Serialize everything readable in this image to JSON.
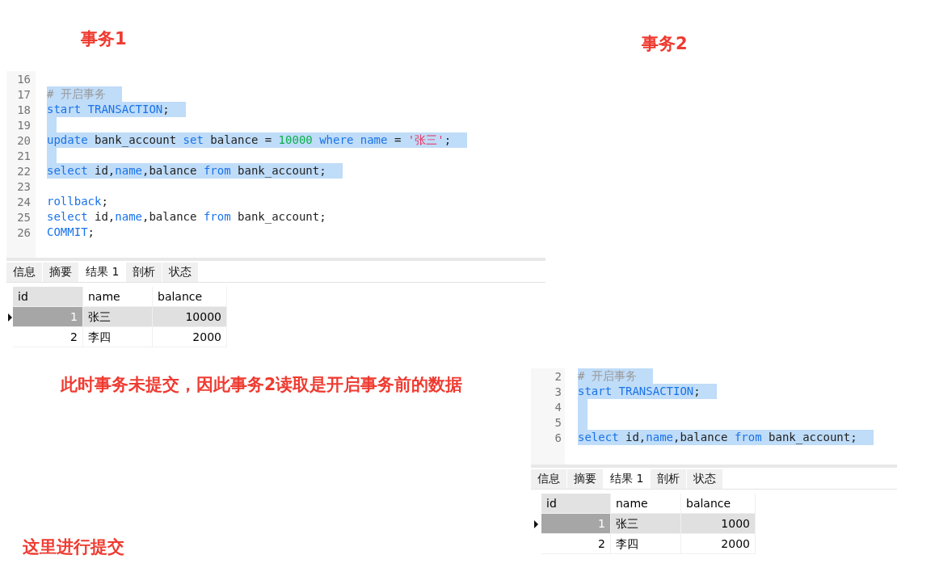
{
  "labels": {
    "transaction_1": "事务1",
    "transaction_2": "事务2",
    "note": "此时事务未提交，因此事务2读取是开启事务前的数据",
    "commit_note": "这里进行提交"
  },
  "editors": [
    {
      "lines": [
        {
          "number": "16",
          "selected": false
        },
        {
          "number": "17",
          "selected": true,
          "tokens": [
            {
              "kind": "comment",
              "text": "# 开启事务"
            }
          ]
        },
        {
          "number": "18",
          "selected": true,
          "tokens": [
            {
              "kind": "kw",
              "text": "start TRANSACTION"
            },
            {
              "kind": "plain",
              "text": ";"
            }
          ]
        },
        {
          "number": "19",
          "selected": true
        },
        {
          "number": "20",
          "selected": true,
          "tokens": [
            {
              "kind": "kw",
              "text": "update"
            },
            {
              "kind": "plain",
              "text": " bank_account "
            },
            {
              "kind": "kw",
              "text": "set"
            },
            {
              "kind": "plain",
              "text": " balance = "
            },
            {
              "kind": "num",
              "text": "10000"
            },
            {
              "kind": "kw",
              "text": " where name"
            },
            {
              "kind": "plain",
              "text": " = "
            },
            {
              "kind": "str",
              "text": "'张三'"
            },
            {
              "kind": "plain",
              "text": ";"
            }
          ]
        },
        {
          "number": "21",
          "selected": true
        },
        {
          "number": "22",
          "selected": true,
          "tokens": [
            {
              "kind": "kw",
              "text": "select"
            },
            {
              "kind": "plain",
              "text": " id,"
            },
            {
              "kind": "kw",
              "text": "name"
            },
            {
              "kind": "plain",
              "text": ",balance "
            },
            {
              "kind": "kw",
              "text": "from"
            },
            {
              "kind": "plain",
              "text": " bank_account;"
            }
          ]
        },
        {
          "number": "23",
          "selected": false
        },
        {
          "number": "24",
          "selected": false,
          "tokens": [
            {
              "kind": "kw",
              "text": "rollback"
            },
            {
              "kind": "plain",
              "text": ";"
            }
          ]
        },
        {
          "number": "25",
          "selected": false,
          "tokens": [
            {
              "kind": "kw",
              "text": "select"
            },
            {
              "kind": "plain",
              "text": " id,"
            },
            {
              "kind": "kw",
              "text": "name"
            },
            {
              "kind": "plain",
              "text": ",balance "
            },
            {
              "kind": "kw",
              "text": "from"
            },
            {
              "kind": "plain",
              "text": " bank_account;"
            }
          ]
        },
        {
          "number": "26",
          "selected": false,
          "tokens": [
            {
              "kind": "kw",
              "text": "COMMIT"
            },
            {
              "kind": "plain",
              "text": ";"
            }
          ]
        }
      ],
      "tabs": [
        {
          "label": "信息",
          "selected": false
        },
        {
          "label": "摘要",
          "selected": false
        },
        {
          "label": "结果 1",
          "selected": true
        },
        {
          "label": "剖析",
          "selected": false
        },
        {
          "label": "状态",
          "selected": false
        }
      ],
      "columns": [
        "id",
        "name",
        "balance"
      ],
      "rows": [
        {
          "selected": true,
          "cells": [
            "1",
            "张三",
            "10000"
          ]
        },
        {
          "selected": false,
          "cells": [
            "2",
            "李四",
            "2000"
          ]
        }
      ]
    },
    {
      "lines": [
        {
          "number": "2",
          "selected": true,
          "tokens": [
            {
              "kind": "comment",
              "text": "# 开启事务"
            }
          ]
        },
        {
          "number": "3",
          "selected": true,
          "tokens": [
            {
              "kind": "kw",
              "text": "start TRANSACTION"
            },
            {
              "kind": "plain",
              "text": ";"
            }
          ]
        },
        {
          "number": "4",
          "selected": true
        },
        {
          "number": "5",
          "selected": true
        },
        {
          "number": "6",
          "selected": true,
          "tokens": [
            {
              "kind": "kw",
              "text": "select"
            },
            {
              "kind": "plain",
              "text": " id,"
            },
            {
              "kind": "kw",
              "text": "name"
            },
            {
              "kind": "plain",
              "text": ",balance "
            },
            {
              "kind": "kw",
              "text": "from"
            },
            {
              "kind": "plain",
              "text": " bank_account;"
            }
          ]
        }
      ],
      "tabs": [
        {
          "label": "信息",
          "selected": false
        },
        {
          "label": "摘要",
          "selected": false
        },
        {
          "label": "结果 1",
          "selected": true
        },
        {
          "label": "剖析",
          "selected": false
        },
        {
          "label": "状态",
          "selected": false
        }
      ],
      "columns": [
        "id",
        "name",
        "balance"
      ],
      "rows": [
        {
          "selected": true,
          "cells": [
            "1",
            "张三",
            "1000"
          ]
        },
        {
          "selected": false,
          "cells": [
            "2",
            "李四",
            "2000"
          ]
        }
      ]
    }
  ]
}
